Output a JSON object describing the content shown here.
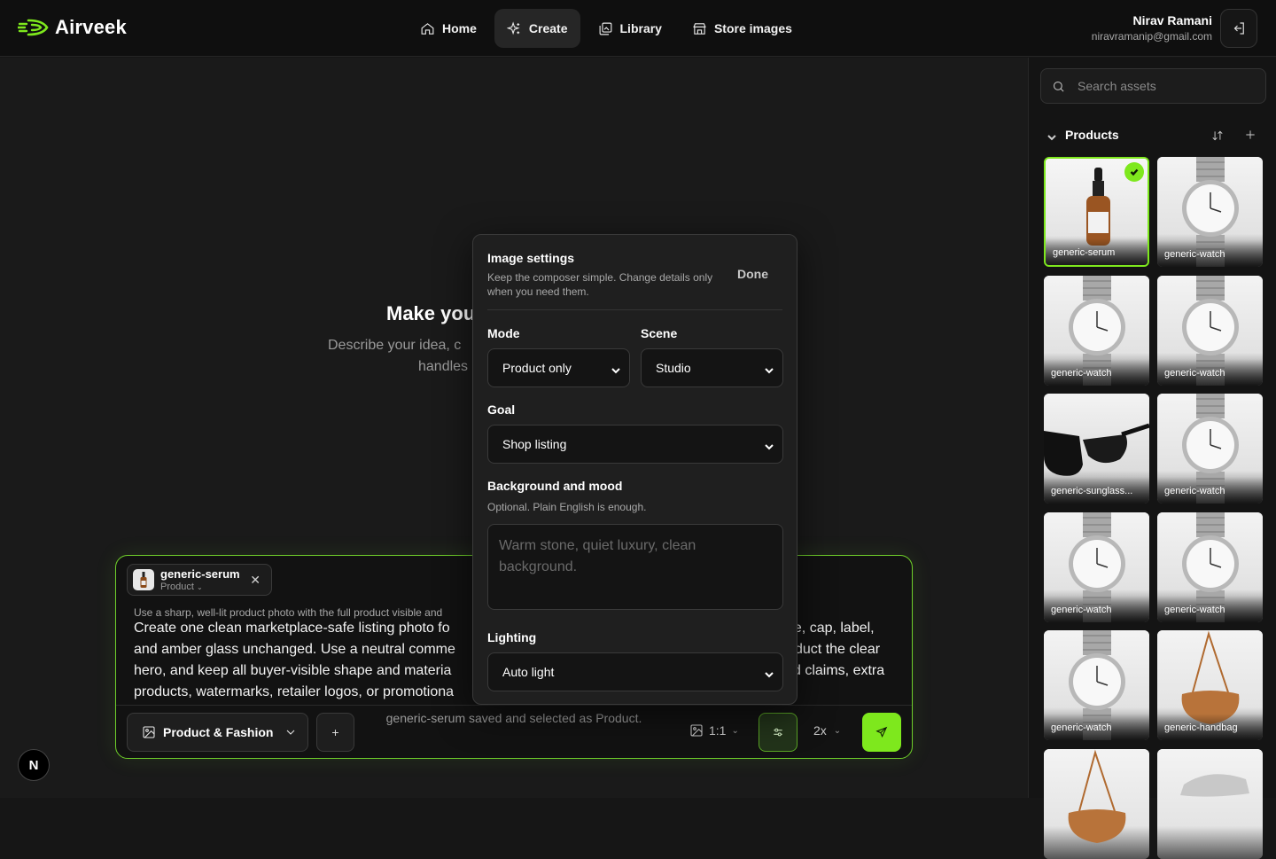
{
  "brand": {
    "name": "Airveek",
    "accent": "#7ee81d"
  },
  "nav": {
    "items": [
      {
        "label": "Home",
        "icon": "home-icon",
        "active": false
      },
      {
        "label": "Create",
        "icon": "sparkle-icon",
        "active": true
      },
      {
        "label": "Library",
        "icon": "library-icon",
        "active": false
      },
      {
        "label": "Store images",
        "icon": "store-icon",
        "active": false
      }
    ]
  },
  "user": {
    "name": "Nirav Ramani",
    "email": "niravramanip@gmail.com"
  },
  "hero": {
    "title": "Make you",
    "sub_line1": "Describe your idea, c",
    "sub_line2": "handles"
  },
  "composer": {
    "chip": {
      "name": "generic-serum",
      "type": "Product"
    },
    "hint": "Use a sharp, well-lit product photo with the full product visible and",
    "prompt_left": [
      "Create one clean marketplace-safe listing photo fo",
      "and amber glass unchanged. Use a neutral comme",
      "hero, and keep all buyer-visible shape and materia",
      "products, watermarks, retailer logos, or promotiona"
    ],
    "prompt_right": [
      "pe, cap, label,",
      "duct the clear",
      "d claims, extra",
      ""
    ],
    "category": "Product & Fashion",
    "add_label": "+",
    "ratio": "1:1",
    "scale": "2x"
  },
  "status": "generic-serum saved and selected as Product.",
  "settings": {
    "title": "Image settings",
    "subtitle": "Keep the composer simple. Change details only when you need them.",
    "done": "Done",
    "mode": {
      "label": "Mode",
      "value": "Product only"
    },
    "scene": {
      "label": "Scene",
      "value": "Studio"
    },
    "goal": {
      "label": "Goal",
      "value": "Shop listing"
    },
    "background": {
      "label": "Background and mood",
      "help": "Optional. Plain English is enough.",
      "placeholder": "Warm stone, quiet luxury, clean background."
    },
    "lighting": {
      "label": "Lighting",
      "value": "Auto light"
    }
  },
  "sidebar": {
    "search_placeholder": "Search assets",
    "section": "Products",
    "assets": [
      {
        "name": "generic-serum",
        "kind": "serum",
        "selected": true
      },
      {
        "name": "generic-watch",
        "kind": "watch",
        "selected": false
      },
      {
        "name": "generic-watch",
        "kind": "watch",
        "selected": false
      },
      {
        "name": "generic-watch",
        "kind": "watch",
        "selected": false
      },
      {
        "name": "generic-sunglass...",
        "kind": "sunglasses",
        "selected": false
      },
      {
        "name": "generic-watch",
        "kind": "watch",
        "selected": false
      },
      {
        "name": "generic-watch",
        "kind": "watch",
        "selected": false
      },
      {
        "name": "generic-watch",
        "kind": "watch",
        "selected": false
      },
      {
        "name": "generic-watch",
        "kind": "watch",
        "selected": false
      },
      {
        "name": "generic-handbag",
        "kind": "handbag",
        "selected": false
      },
      {
        "name": "",
        "kind": "handbag",
        "selected": false
      },
      {
        "name": "",
        "kind": "sneaker",
        "selected": false
      }
    ]
  },
  "badge": "N"
}
